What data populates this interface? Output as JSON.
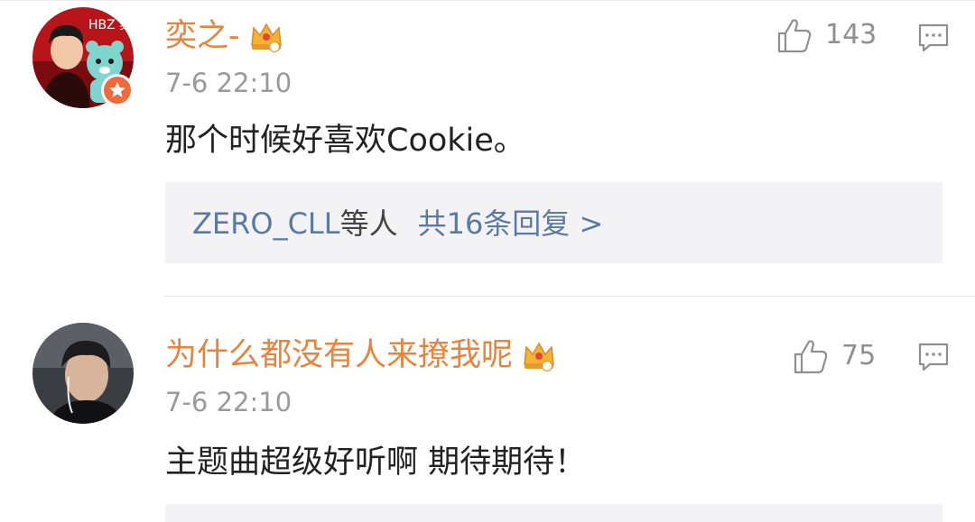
{
  "comments": [
    {
      "username": "奕之-",
      "timestamp": "7-6 22:10",
      "content": "那个时候好喜欢Cookie。",
      "likes": "143",
      "avatar_text": "HBZ 奕之",
      "reply_summary": {
        "users": "ZERO_CLL",
        "suffix": "等人",
        "count_text": "共16条回复 >"
      }
    },
    {
      "username": "为什么都没有人来撩我呢",
      "timestamp": "7-6 22:10",
      "content": "主题曲超级好听啊 期待期待！",
      "likes": "75"
    }
  ],
  "icons": {
    "like": "thumbs-up-icon",
    "reply": "comment-icon",
    "member": "crown-badge-icon",
    "verified": "star-badge-icon"
  },
  "colors": {
    "username": "#e8833c",
    "link": "#5b7aa3",
    "timestamp": "#9a9a9a",
    "reply_bg": "#f3f3f5"
  }
}
